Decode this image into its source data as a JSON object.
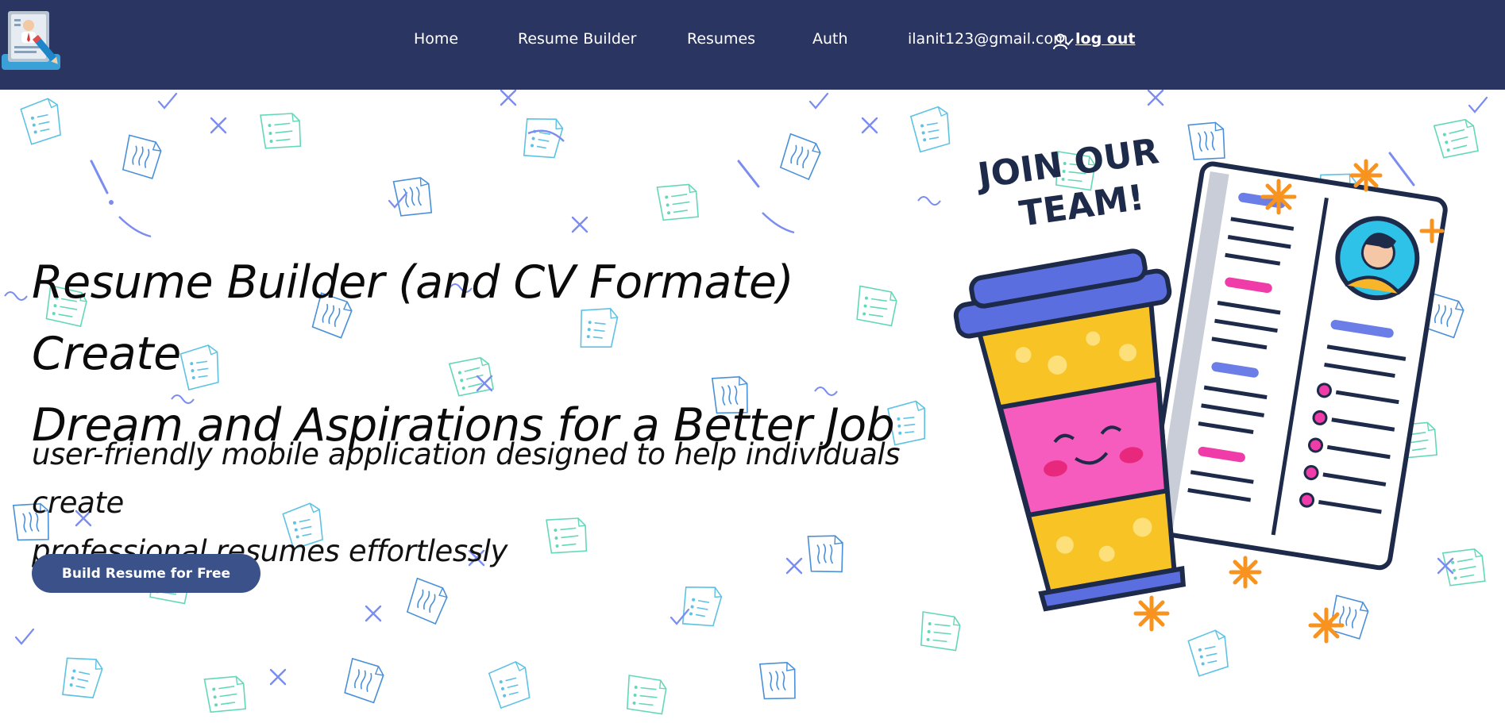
{
  "nav": {
    "links": [
      {
        "label": "Home"
      },
      {
        "label": "Resume Builder"
      },
      {
        "label": "Resumes"
      },
      {
        "label": "Auth"
      }
    ],
    "user_email": "ilanit123@gmail.com",
    "logout_label": "log out"
  },
  "hero": {
    "title_line1": "Resume Builder (and CV Formate) Create",
    "title_line2": "Dream and Aspirations for a Better Job",
    "subtitle_line1": "user-friendly mobile application designed to help individuals create",
    "subtitle_line2": "professional resumes effortlessly",
    "cta_label": "Build Resume for Free"
  },
  "illustration": {
    "sign_line1": "JOIN OUR",
    "sign_line2": "TEAM!"
  },
  "colors": {
    "navbar": "#2b3561",
    "cta": "#3a5189",
    "pattern_blue": "#4a90d9",
    "pattern_mint": "#5fd3c0"
  },
  "icons": {
    "logo": "resume-logo-icon",
    "user": "user-check-icon"
  }
}
